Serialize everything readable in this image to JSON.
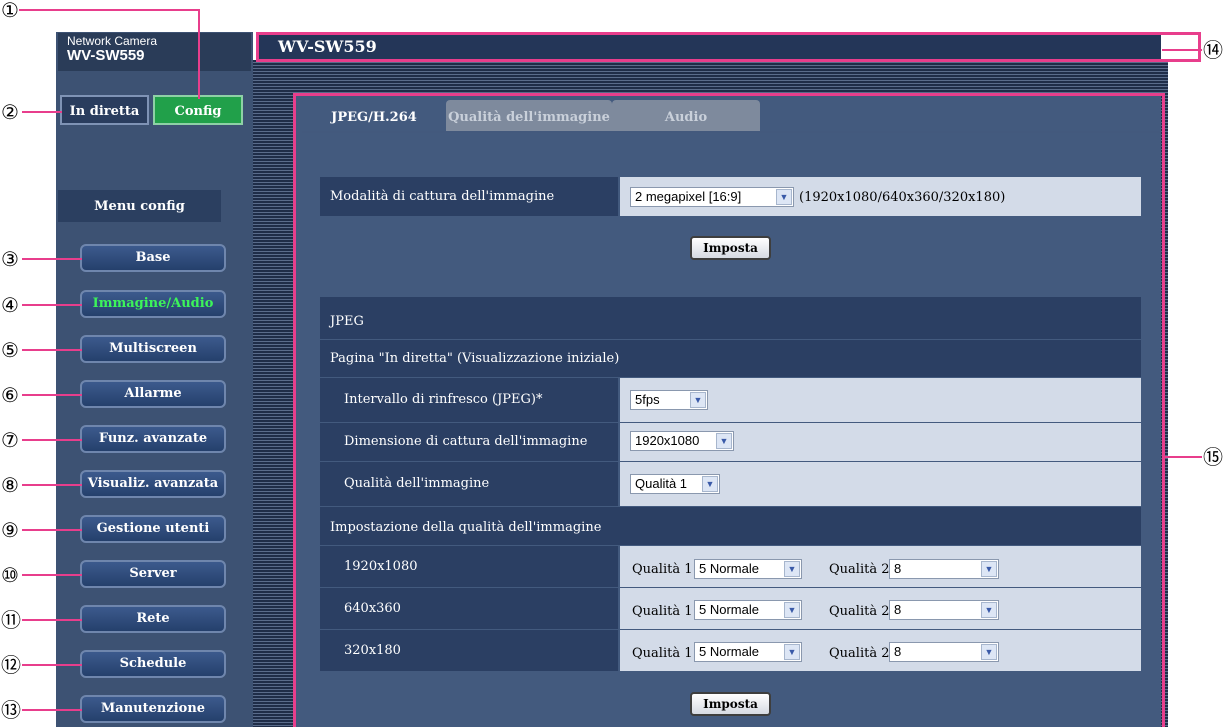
{
  "brand": {
    "subtitle": "Network Camera",
    "model": "WV-SW559"
  },
  "topnav": {
    "live": "In diretta",
    "config": "Config"
  },
  "menu": {
    "title": "Menu config",
    "items": [
      {
        "label": "Base"
      },
      {
        "label": "Immagine/Audio",
        "active": true
      },
      {
        "label": "Multiscreen"
      },
      {
        "label": "Allarme"
      },
      {
        "label": "Funz. avanzate"
      },
      {
        "label": "Visualiz. avanzata"
      },
      {
        "label": "Gestione utenti"
      },
      {
        "label": "Server"
      },
      {
        "label": "Rete"
      },
      {
        "label": "Schedule"
      },
      {
        "label": "Manutenzione"
      }
    ]
  },
  "header": {
    "title": "WV-SW559"
  },
  "tabs": [
    {
      "label": "JPEG/H.264",
      "active": true
    },
    {
      "label": "Qualità dell'immagine"
    },
    {
      "label": "Audio"
    }
  ],
  "capture": {
    "label": "Modalità di cattura dell'immagine",
    "value": "2 megapixel [16:9]",
    "note": "(1920x1080/640x360/320x180)"
  },
  "buttons": {
    "set": "Imposta"
  },
  "jpeg": {
    "section": "JPEG",
    "live_page": "Pagina \"In diretta\" (Visualizzazione iniziale)",
    "refresh_label": "Intervallo di rinfresco (JPEG)*",
    "refresh_value": "5fps",
    "size_label": "Dimensione di cattura dell'immagine",
    "size_value": "1920x1080",
    "quality_label": "Qualità dell'immagine",
    "quality_value": "Qualità 1",
    "quality_settings": "Impostazione della qualità dell'immagine",
    "q1_label": "Qualità 1",
    "q2_label": "Qualità 2",
    "resolutions": [
      {
        "name": "1920x1080",
        "q1": "5 Normale",
        "q2": "8"
      },
      {
        "name": "640x360",
        "q1": "5 Normale",
        "q2": "8"
      },
      {
        "name": "320x180",
        "q1": "5 Normale",
        "q2": "8"
      }
    ]
  },
  "callouts": [
    "①",
    "②",
    "③",
    "④",
    "⑤",
    "⑥",
    "⑦",
    "⑧",
    "⑨",
    "⑩",
    "⑪",
    "⑫",
    "⑬",
    "⑭",
    "⑮"
  ],
  "colors": {
    "callout": "#e83e8c",
    "config_active": "#21a04a",
    "menu_active_text": "#3cf45a"
  }
}
